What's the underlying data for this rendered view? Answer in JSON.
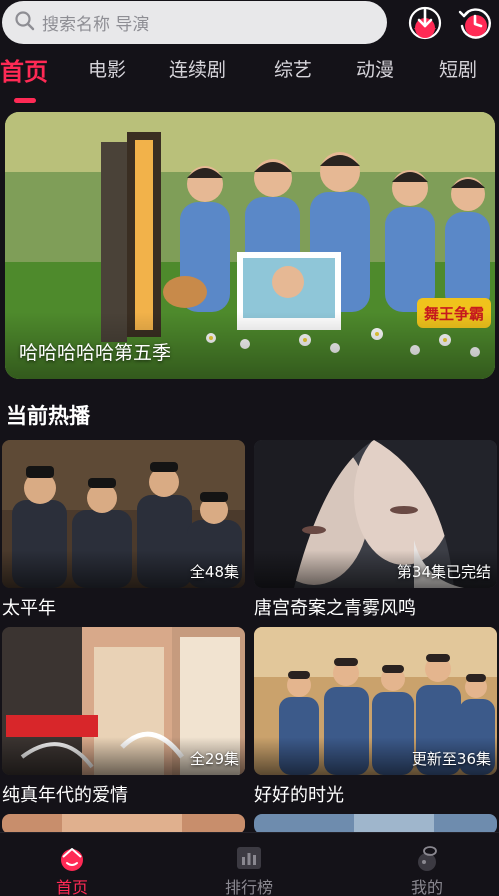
{
  "search": {
    "placeholder": "搜索名称 导演"
  },
  "header_icons": [
    {
      "icon": "download-icon"
    },
    {
      "icon": "history-icon"
    }
  ],
  "tabs": [
    {
      "label": "首页",
      "active": true
    },
    {
      "label": "电影",
      "active": false
    },
    {
      "label": "连续剧",
      "active": false
    },
    {
      "label": "综艺",
      "active": false
    },
    {
      "label": "动漫",
      "active": false
    },
    {
      "label": "短剧",
      "active": false
    }
  ],
  "banner": {
    "title": "哈哈哈哈哈第五季",
    "stamp_text": "舞王争霸"
  },
  "section": {
    "title": "当前热播"
  },
  "cards": [
    {
      "title": "太平年",
      "episodes": "全48集"
    },
    {
      "title": "唐宫奇案之青雾风鸣",
      "episodes": "第34集已完结"
    },
    {
      "title": "纯真年代的爱情",
      "episodes": "全29集"
    },
    {
      "title": "好好的时光",
      "episodes": "更新至36集"
    }
  ],
  "bottom_nav": [
    {
      "label": "首页",
      "icon": "home-icon",
      "active": true
    },
    {
      "label": "排行榜",
      "icon": "ranking-icon",
      "active": false
    },
    {
      "label": "我的",
      "icon": "profile-icon",
      "active": false
    }
  ],
  "colors": {
    "accent": "#ff2a55",
    "background": "#141218",
    "search_bg": "#e8e8ea"
  }
}
